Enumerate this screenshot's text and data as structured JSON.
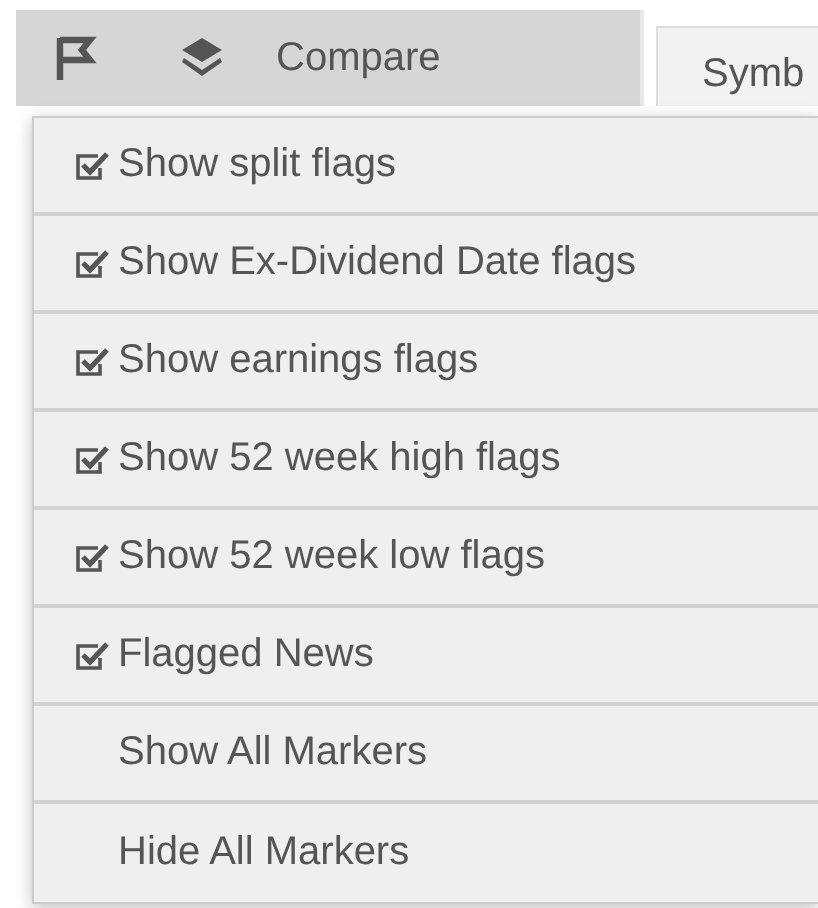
{
  "toolbar": {
    "compare_label": "Compare",
    "tab_label": "Symb"
  },
  "menu": {
    "items": [
      {
        "kind": "checkbox",
        "label": "Show split flags",
        "checked": true
      },
      {
        "kind": "checkbox",
        "label": "Show Ex-Dividend Date flags",
        "checked": true
      },
      {
        "kind": "checkbox",
        "label": "Show earnings flags",
        "checked": true
      },
      {
        "kind": "checkbox",
        "label": "Show 52 week high flags",
        "checked": true
      },
      {
        "kind": "checkbox",
        "label": "Show 52 week low flags",
        "checked": true
      },
      {
        "kind": "checkbox",
        "label": "Flagged News",
        "checked": true
      },
      {
        "kind": "action",
        "label": "Show All Markers"
      },
      {
        "kind": "action",
        "label": "Hide All Markers"
      }
    ]
  }
}
